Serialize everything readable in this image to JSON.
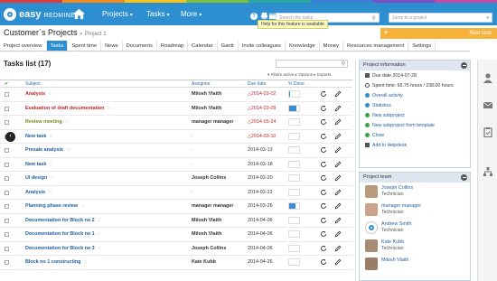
{
  "brand": {
    "name": "easy",
    "suffix": "REDMINE",
    "colors": [
      "#e03b3b",
      "#f28a1b",
      "#f7c51a",
      "#7fbf3f",
      "#2aa8a1",
      "#3b7fd6",
      "#7a4fc4",
      "#c34aa0"
    ]
  },
  "topnav": {
    "projects": "Projects",
    "tasks": "Tasks",
    "more": "More"
  },
  "search": {
    "placeholder": "Search the tasks",
    "jump_placeholder": "Jump to a project"
  },
  "tooltip": "Help for this feature is available",
  "breadcrumb": {
    "title": "Customer`s Projects",
    "separator": "»",
    "sub": "Project 1"
  },
  "new_task": {
    "plus": "+",
    "label": "New task"
  },
  "tabs": [
    "Project overview",
    "Tasks",
    "Spent time",
    "News",
    "Documents",
    "Roadmap",
    "Calendar",
    "Gantt",
    "Invite colleagues",
    "Knowledge",
    "Money",
    "Resources management",
    "Settings"
  ],
  "tasks": {
    "title": "Tasks list (17)",
    "options": "▾ Filters active  ▸ Options  ▸ Exports",
    "columns": {
      "check": "✔",
      "subject": "Subject",
      "assignee": "Assignee",
      "due": "Due date",
      "done": "% Done"
    },
    "rows": [
      {
        "subject": "Analysis",
        "subject_color": "red",
        "assignee": "Milosh Vlaith",
        "due": "2014-03-02",
        "due_overdue": true,
        "done": 10
      },
      {
        "subject": "Evaluation of draft documentation",
        "subject_color": "red",
        "assignee": "Milosh Vlaith",
        "due": "2014-03-09",
        "due_overdue": true,
        "done": 70
      },
      {
        "subject": "Review meeting",
        "subject_color": "green",
        "assignee": "manager manager",
        "due": "2014-05-24",
        "due_overdue": true,
        "done": 0
      },
      {
        "subject": "New task",
        "subject_color": "blue",
        "assignee": "-",
        "due": "2014-03-10",
        "due_overdue": true,
        "done": 0
      },
      {
        "subject": "Presale analysis",
        "subject_color": "blue",
        "assignee": "-",
        "due": "2014-03-13",
        "due_overdue": false,
        "done": 0
      },
      {
        "subject": "New task",
        "subject_color": "blue",
        "assignee": "-",
        "due": "2014-03-18",
        "due_overdue": false,
        "done": 0
      },
      {
        "subject": "UI design",
        "subject_color": "blue",
        "assignee": "Joseph Collins",
        "due": "2014-03-20",
        "due_overdue": false,
        "done": 0
      },
      {
        "subject": "Analysis",
        "subject_color": "blue",
        "assignee": "-",
        "due": "2014-03-22",
        "due_overdue": false,
        "done": 0
      },
      {
        "subject": "Planning phase review",
        "subject_color": "blue",
        "assignee": "manager manager",
        "due": "2014-03-26",
        "due_overdue": false,
        "done": 60
      },
      {
        "subject": "Documentation for Block no 2",
        "subject_color": "blue",
        "assignee": "Milosh Vlaith",
        "due": "2014-04-06",
        "due_overdue": false,
        "done": 0
      },
      {
        "subject": "Documentation for Block no 1",
        "subject_color": "blue",
        "assignee": "Milosh Vlaith",
        "due": "2014-04-06",
        "due_overdue": false,
        "done": 0
      },
      {
        "subject": "Documentation for Block no 3",
        "subject_color": "blue",
        "assignee": "Joseph Collins",
        "due": "2014-04-06",
        "due_overdue": false,
        "done": 0
      },
      {
        "subject": "Block no 1 constructing",
        "subject_color": "blue",
        "assignee": "Kate Kubb",
        "due": "2014-04-26",
        "due_overdue": false,
        "done": 0
      }
    ]
  },
  "project_info": {
    "title": "Project information",
    "due": "Due date 2014-07-28",
    "spent": "Spent time: 65.75 hours / 238.00 hours",
    "links": [
      "Overall activity",
      "Statistics",
      "New subproject",
      "New subproject from template",
      "Close",
      "Add to Helpdesk"
    ]
  },
  "team": {
    "title": "Project team",
    "members": [
      {
        "name": "Joseph Collins",
        "role": "Technician"
      },
      {
        "name": "manager manager",
        "role": "Technician"
      },
      {
        "name": "Andrew Smith",
        "role": "Technician"
      },
      {
        "name": "Kate Kubb",
        "role": "Technician"
      },
      {
        "name": "Milosh Vlaith",
        "role": ""
      }
    ]
  },
  "icons": {
    "home": "home-icon",
    "help": "question-icon",
    "printer": "printer-icon",
    "calendar": "calendar-icon",
    "search": "search-icon",
    "user": "user-icon",
    "mail": "mail-icon",
    "clipboard": "clipboard-icon",
    "sitemap": "sitemap-icon"
  }
}
